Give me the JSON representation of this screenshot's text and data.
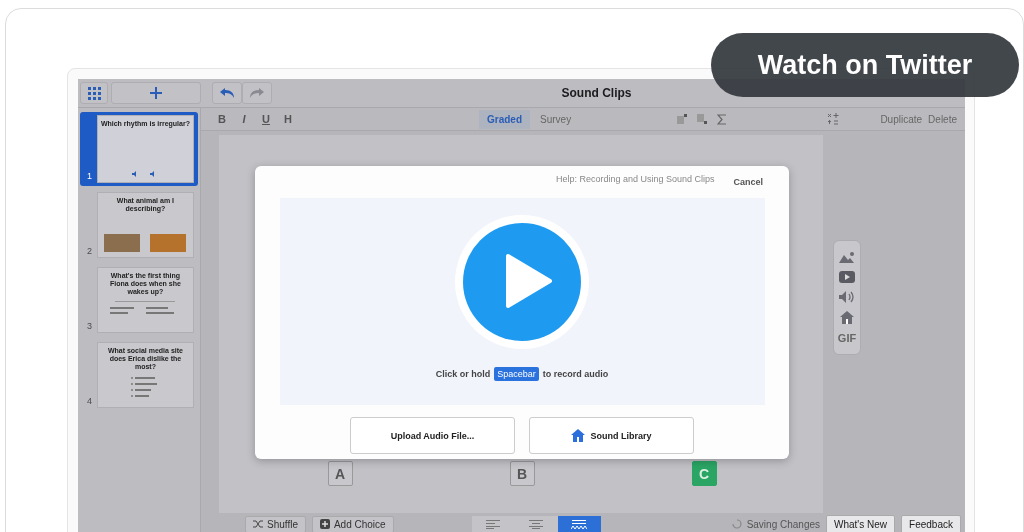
{
  "embed_button": {
    "label": "Watch on Twitter"
  },
  "app": {
    "title": "Sound Clips",
    "format_buttons": [
      "B",
      "I",
      "U",
      "H"
    ],
    "modes": [
      {
        "label": "Graded",
        "selected": true
      },
      {
        "label": "Survey",
        "selected": false
      }
    ],
    "slide_actions": [
      "Duplicate",
      "Delete"
    ],
    "slides": [
      {
        "number": "1",
        "selected": true,
        "kind": "audio",
        "question": "Which rhythm is irregular?"
      },
      {
        "number": "2",
        "selected": false,
        "kind": "images",
        "question": "What animal am I describing?"
      },
      {
        "number": "3",
        "selected": false,
        "kind": "options",
        "question": "What's the first thing Fiona does when she wakes up?"
      },
      {
        "number": "4",
        "selected": false,
        "kind": "list",
        "question": "What social media site does Erica dislike the most?"
      }
    ],
    "modal": {
      "help_link": "Help: Recording and Using Sound Clips",
      "cancel": "Cancel",
      "prompt_before": "Click or hold",
      "key": "Spacebar",
      "prompt_after": "to record audio",
      "buttons": [
        {
          "kind": "upload",
          "label": "Upload Audio File..."
        },
        {
          "kind": "library",
          "label": "Sound Library"
        }
      ]
    },
    "media_tools": [
      {
        "kind": "image"
      },
      {
        "kind": "video"
      },
      {
        "kind": "audio"
      },
      {
        "kind": "library"
      },
      {
        "kind": "gif",
        "label": "GIF"
      }
    ],
    "choices": [
      {
        "label": "A",
        "selected": false
      },
      {
        "label": "B",
        "selected": false
      },
      {
        "label": "C",
        "selected": true
      }
    ],
    "bottom_left": [
      {
        "kind": "shuffle",
        "label": "Shuffle"
      },
      {
        "kind": "add",
        "label": "Add Choice"
      }
    ],
    "alignments": [
      {
        "kind": "left",
        "selected": false
      },
      {
        "kind": "center",
        "selected": false
      },
      {
        "kind": "grid",
        "selected": true
      }
    ],
    "status": "Saving Changes",
    "bottom_right": [
      "What's New",
      "Feedback"
    ]
  }
}
